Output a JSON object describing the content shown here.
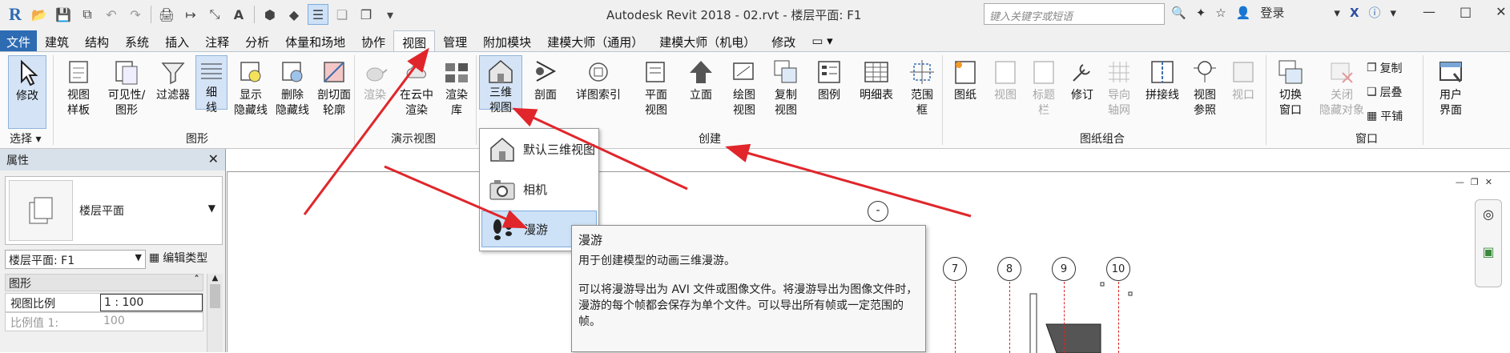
{
  "title": "Autodesk Revit 2018 -     02.rvt - 楼层平面: F1",
  "search": {
    "placeholder": "键入关键字或短语"
  },
  "user": {
    "login": "登录"
  },
  "menu": {
    "tabs": [
      "文件",
      "建筑",
      "结构",
      "系统",
      "插入",
      "注释",
      "分析",
      "体量和场地",
      "协作",
      "视图",
      "管理",
      "附加模块",
      "建模大师（通用）",
      "建模大师（机电）",
      "修改"
    ],
    "active_index": 9
  },
  "ribbon": {
    "select": {
      "modify": "修改",
      "group": "选择"
    },
    "graphics": {
      "buttons": [
        {
          "l1": "视图",
          "l2": "样板"
        },
        {
          "l1": "可见性/",
          "l2": "图形"
        },
        {
          "l1": "过滤器",
          "l2": ""
        },
        {
          "l1": "细",
          "l2": "线"
        },
        {
          "l1": "显示",
          "l2": "隐藏线"
        },
        {
          "l1": "删除",
          "l2": "隐藏线"
        },
        {
          "l1": "剖切面",
          "l2": "轮廓"
        }
      ],
      "group": "图形"
    },
    "presentation": {
      "buttons": [
        {
          "l1": "渲染",
          "l2": ""
        },
        {
          "l1": "在云中",
          "l2": "渲染"
        },
        {
          "l1": "渲染",
          "l2": "库"
        }
      ],
      "group": "演示视图"
    },
    "create": {
      "buttons": [
        {
          "l1": "三维",
          "l2": "视图"
        },
        {
          "l1": "剖面",
          "l2": ""
        },
        {
          "l1": "详图索引",
          "l2": ""
        },
        {
          "l1": "平面",
          "l2": "视图"
        },
        {
          "l1": "立面",
          "l2": ""
        },
        {
          "l1": "绘图",
          "l2": "视图"
        },
        {
          "l1": "复制",
          "l2": "视图"
        },
        {
          "l1": "图例",
          "l2": ""
        },
        {
          "l1": "明细表",
          "l2": ""
        },
        {
          "l1": "范围",
          "l2": "框"
        }
      ],
      "group": "创建"
    },
    "sheet": {
      "buttons": [
        {
          "l1": "图纸",
          "l2": ""
        },
        {
          "l1": "视图",
          "l2": ""
        },
        {
          "l1": "标题",
          "l2": "栏"
        },
        {
          "l1": "修订",
          "l2": ""
        },
        {
          "l1": "导向",
          "l2": "轴网"
        },
        {
          "l1": "拼接线",
          "l2": ""
        },
        {
          "l1": "视图",
          "l2": "参照"
        },
        {
          "l1": "视口",
          "l2": ""
        }
      ],
      "group": "图纸组合"
    },
    "window": {
      "buttons": [
        {
          "l1": "切换",
          "l2": "窗口"
        },
        {
          "l1": "关闭",
          "l2": "隐藏对象"
        }
      ],
      "small": [
        "复制",
        "层叠",
        "平铺"
      ],
      "user": {
        "l1": "用户",
        "l2": "界面"
      },
      "group": "窗口"
    }
  },
  "dropdown": {
    "items": [
      "默认三维视图",
      "相机",
      "漫游"
    ]
  },
  "tooltip": {
    "title": "漫游",
    "line1": "用于创建模型的动画三维漫游。",
    "line2": "可以将漫游导出为 AVI 文件或图像文件。将漫游导出为图像文件时，漫游的每个帧都会保存为单个文件。可以导出所有帧或一定范围的帧。"
  },
  "properties": {
    "title": "属性",
    "type_name": "楼层平面",
    "selector": "楼层平面: F1",
    "edit_type": "编辑类型",
    "section": "图形",
    "rows": [
      {
        "label": "视图比例",
        "value": "1 : 100"
      },
      {
        "label": "比例值 1:",
        "value": "100"
      }
    ]
  },
  "canvas": {
    "grid_labels": [
      "7",
      "8",
      "9",
      "10"
    ]
  },
  "colors": {
    "file_tab": "#2d6bb3",
    "annotation_arrow": "#e0262b",
    "highlight": "#cde1f7"
  }
}
